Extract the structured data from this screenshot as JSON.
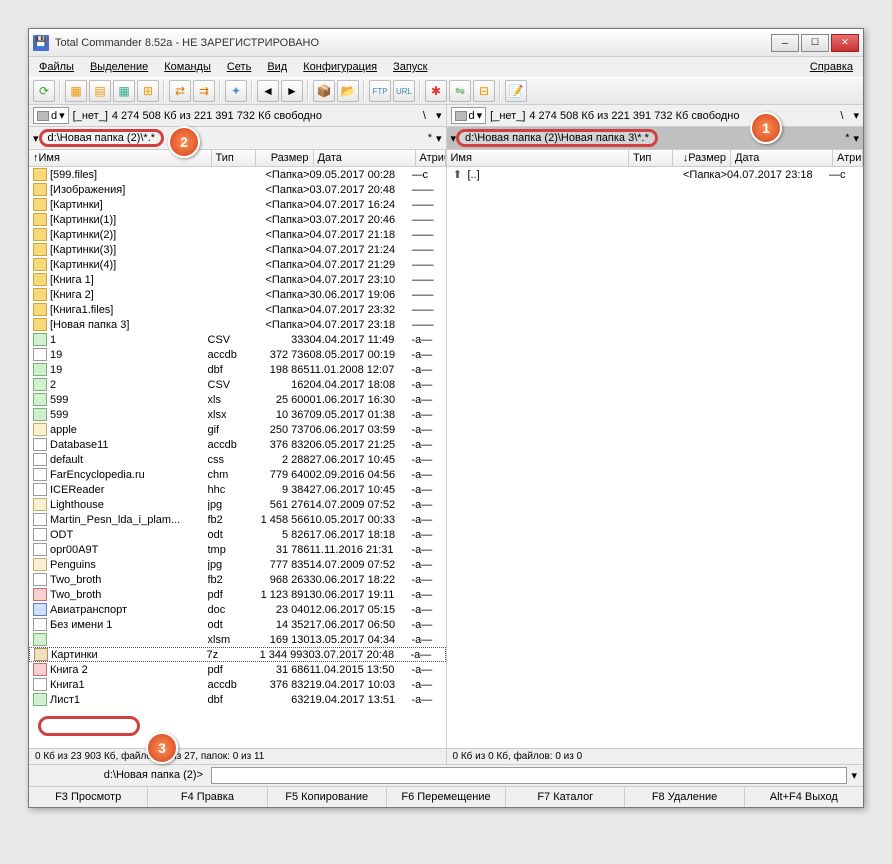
{
  "title": "Total Commander 8.52a - НЕ ЗАРЕГИСТРИРОВАНО",
  "menu": {
    "files": "Файлы",
    "selection": "Выделение",
    "commands": "Команды",
    "net": "Сеть",
    "view": "Вид",
    "config": "Конфигурация",
    "launch": "Запуск",
    "help": "Справка"
  },
  "drive": {
    "letter": "d",
    "label": "[_нет_]",
    "space": "4 274 508 Кб из 221 391 732 Кб свободно"
  },
  "left_path": "d:\\Новая папка (2)\\*.*",
  "right_path": "d:\\Новая папка (2)\\Новая папка 3\\*.*",
  "headers": {
    "name": "Имя",
    "ext": "Тип",
    "size": "Размер",
    "date": "Дата",
    "attr": "Атрибу"
  },
  "left_files": [
    {
      "icon": "folder",
      "name": "[599.files]",
      "ext": "",
      "size": "<Папка>",
      "date": "09.05.2017 00:28",
      "attr": "—c"
    },
    {
      "icon": "folder",
      "name": "[Изображения]",
      "ext": "",
      "size": "<Папка>",
      "date": "03.07.2017 20:48",
      "attr": "——"
    },
    {
      "icon": "folder",
      "name": "[Картинки]",
      "ext": "",
      "size": "<Папка>",
      "date": "04.07.2017 16:24",
      "attr": "——"
    },
    {
      "icon": "folder",
      "name": "[Картинки(1)]",
      "ext": "",
      "size": "<Папка>",
      "date": "03.07.2017 20:46",
      "attr": "——"
    },
    {
      "icon": "folder",
      "name": "[Картинки(2)]",
      "ext": "",
      "size": "<Папка>",
      "date": "04.07.2017 21:18",
      "attr": "——"
    },
    {
      "icon": "folder",
      "name": "[Картинки(3)]",
      "ext": "",
      "size": "<Папка>",
      "date": "04.07.2017 21:24",
      "attr": "——"
    },
    {
      "icon": "folder",
      "name": "[Картинки(4)]",
      "ext": "",
      "size": "<Папка>",
      "date": "04.07.2017 21:29",
      "attr": "——"
    },
    {
      "icon": "folder",
      "name": "[Книга 1]",
      "ext": "",
      "size": "<Папка>",
      "date": "04.07.2017 23:10",
      "attr": "——"
    },
    {
      "icon": "folder",
      "name": "[Книга 2]",
      "ext": "",
      "size": "<Папка>",
      "date": "30.06.2017 19:06",
      "attr": "——"
    },
    {
      "icon": "folder",
      "name": "[Книга1.files]",
      "ext": "",
      "size": "<Папка>",
      "date": "04.07.2017 23:32",
      "attr": "——"
    },
    {
      "icon": "folder",
      "name": "[Новая папка 3]",
      "ext": "",
      "size": "<Папка>",
      "date": "04.07.2017 23:18",
      "attr": "——"
    },
    {
      "icon": "xls",
      "name": "1",
      "ext": "CSV",
      "size": "333",
      "date": "04.04.2017 11:49",
      "attr": "-a—"
    },
    {
      "icon": "file",
      "name": "19",
      "ext": "accdb",
      "size": "372 736",
      "date": "08.05.2017 00:19",
      "attr": "-a—"
    },
    {
      "icon": "xls",
      "name": "19",
      "ext": "dbf",
      "size": "198 865",
      "date": "11.01.2008 12:07",
      "attr": "-a—"
    },
    {
      "icon": "xls",
      "name": "2",
      "ext": "CSV",
      "size": "162",
      "date": "04.04.2017 18:08",
      "attr": "-a—"
    },
    {
      "icon": "xls",
      "name": "599",
      "ext": "xls",
      "size": "25 600",
      "date": "01.06.2017 16:30",
      "attr": "-a—"
    },
    {
      "icon": "xls",
      "name": "599",
      "ext": "xlsx",
      "size": "10 367",
      "date": "09.05.2017 01:38",
      "attr": "-a—"
    },
    {
      "icon": "img",
      "name": "apple",
      "ext": "gif",
      "size": "250 737",
      "date": "06.06.2017 03:59",
      "attr": "-a—"
    },
    {
      "icon": "file",
      "name": "Database11",
      "ext": "accdb",
      "size": "376 832",
      "date": "06.05.2017 21:25",
      "attr": "-a—"
    },
    {
      "icon": "file",
      "name": "default",
      "ext": "css",
      "size": "2 288",
      "date": "27.06.2017 10:45",
      "attr": "-a—"
    },
    {
      "icon": "file",
      "name": "FarEncyclopedia.ru",
      "ext": "chm",
      "size": "779 640",
      "date": "02.09.2016 04:56",
      "attr": "-a—"
    },
    {
      "icon": "file",
      "name": "ICEReader",
      "ext": "hhc",
      "size": "9 384",
      "date": "27.06.2017 10:45",
      "attr": "-a—"
    },
    {
      "icon": "img",
      "name": "Lighthouse",
      "ext": "jpg",
      "size": "561 276",
      "date": "14.07.2009 07:52",
      "attr": "-a—"
    },
    {
      "icon": "file",
      "name": "Martin_Pesn_lda_i_plam...",
      "ext": "fb2",
      "size": "1 458 566",
      "date": "10.05.2017 00:33",
      "attr": "-a—"
    },
    {
      "icon": "file",
      "name": "ODT",
      "ext": "odt",
      "size": "5 826",
      "date": "17.06.2017 18:18",
      "attr": "-a—"
    },
    {
      "icon": "file",
      "name": "opr00A9T",
      "ext": "tmp",
      "size": "31 786",
      "date": "11.11.2016 21:31",
      "attr": "-a—"
    },
    {
      "icon": "img",
      "name": "Penguins",
      "ext": "jpg",
      "size": "777 835",
      "date": "14.07.2009 07:52",
      "attr": "-a—"
    },
    {
      "icon": "file",
      "name": "Two_broth",
      "ext": "fb2",
      "size": "968 263",
      "date": "30.06.2017 18:22",
      "attr": "-a—"
    },
    {
      "icon": "pdf",
      "name": "Two_broth",
      "ext": "pdf",
      "size": "1 123 891",
      "date": "30.06.2017 19:11",
      "attr": "-a—"
    },
    {
      "icon": "doc",
      "name": "Авиатранспорт",
      "ext": "doc",
      "size": "23 040",
      "date": "12.06.2017 05:15",
      "attr": "-a—"
    },
    {
      "icon": "file",
      "name": "Без имени 1",
      "ext": "odt",
      "size": "14 352",
      "date": "17.06.2017 06:50",
      "attr": "-a—"
    },
    {
      "icon": "xls",
      "name": "",
      "ext": "xlsm",
      "size": "169 130",
      "date": "13.05.2017 04:34",
      "attr": "-a—"
    },
    {
      "icon": "zip",
      "name": "Картинки",
      "ext": "7z",
      "size": "1 344 993",
      "date": "03.07.2017 20:48",
      "attr": "-a—",
      "selected": true
    },
    {
      "icon": "pdf",
      "name": "Книга 2",
      "ext": "pdf",
      "size": "31 686",
      "date": "11.04.2015 13:50",
      "attr": "-a—"
    },
    {
      "icon": "file",
      "name": "Книга1",
      "ext": "accdb",
      "size": "376 832",
      "date": "19.04.2017 10:03",
      "attr": "-a—"
    },
    {
      "icon": "xls",
      "name": "Лист1",
      "ext": "dbf",
      "size": "632",
      "date": "19.04.2017 13:51",
      "attr": "-a—"
    }
  ],
  "right_files": [
    {
      "icon": "up",
      "name": "[..]",
      "ext": "",
      "size": "<Папка>",
      "date": "04.07.2017 23:18",
      "attr": "—c"
    }
  ],
  "status_left": "0 Кб из 23 903 Кб, файлов: 0 из 27, папок: 0 из 11",
  "status_right": "0 Кб из 0 Кб, файлов: 0 из 0",
  "cmd_path": "d:\\Новая папка (2)>",
  "func": {
    "f3": "F3 Просмотр",
    "f4": "F4 Правка",
    "f5": "F5 Копирование",
    "f6": "F6 Перемещение",
    "f7": "F7 Каталог",
    "f8": "F8 Удаление",
    "altf4": "Alt+F4 Выход"
  }
}
